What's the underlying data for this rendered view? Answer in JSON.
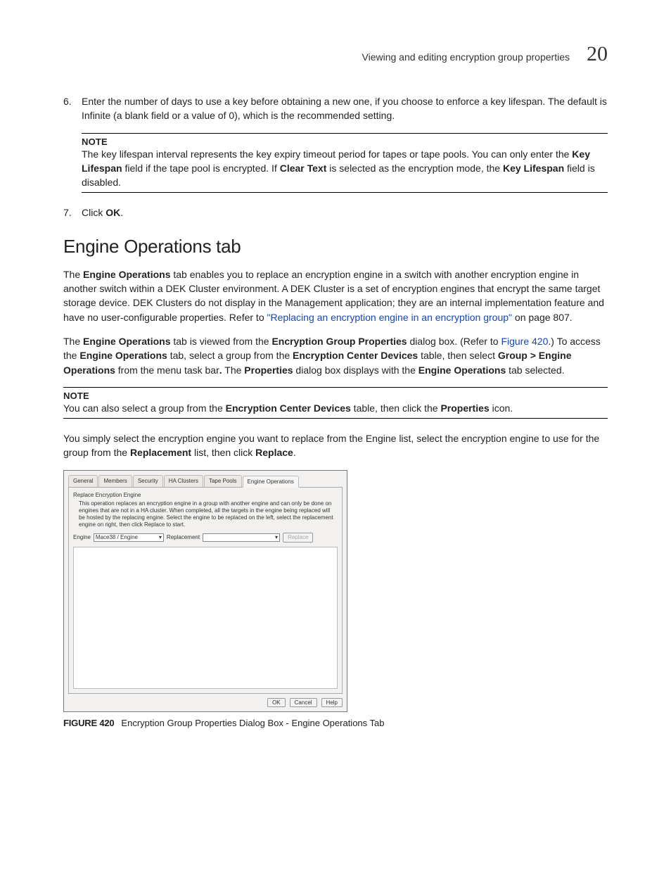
{
  "header": {
    "title": "Viewing and editing encryption group properties",
    "chapter": "20"
  },
  "step6_num": "6.",
  "step6_text": "Enter the number of days to use a key before obtaining a new one, if you choose to enforce a key lifespan. The default is Infinite (a blank field or a value of 0), which is the recommended setting.",
  "note1_head": "NOTE",
  "note1_a": "The key lifespan interval represents the key expiry timeout period for tapes or tape pools. You can only enter the ",
  "note1_b": "Key Lifespan",
  "note1_c": " field if the tape pool is encrypted. If ",
  "note1_d": "Clear Text",
  "note1_e": " is selected as the encryption mode, the ",
  "note1_f": "Key Lifespan",
  "note1_g": " field is disabled.",
  "step7_num": "7.",
  "step7_a": "Click ",
  "step7_b": "OK",
  "step7_c": ".",
  "h2": "Engine Operations tab",
  "p1_a": "The ",
  "p1_b": "Engine Operations",
  "p1_c": " tab enables you to replace an encryption engine in a switch with another encryption engine in another switch within a DEK Cluster environment. A DEK Cluster is a set of encryption engines that encrypt the same target storage device. DEK Clusters do not display in the Management application; they are an internal implementation feature and have no user-configurable properties. Refer to ",
  "p1_link": "\"Replacing an encryption engine in an encryption group\"",
  "p1_d": " on page 807.",
  "p2_a": "The ",
  "p2_b": "Engine Operations",
  "p2_c": " tab is viewed from the ",
  "p2_d": "Encryption Group Properties",
  "p2_e": " dialog box. (Refer to ",
  "p2_link": "Figure 420",
  "p2_f": ".) To access the ",
  "p2_g": "Engine Operations",
  "p2_h": " tab, select a group from the ",
  "p2_i": "Encryption Center Devices",
  "p2_j": " table, then select ",
  "p2_k": "Group > Engine Operations",
  "p2_l": " from the menu task bar",
  "p2_m": ".",
  "p2_n": " The ",
  "p2_o": "Properties",
  "p2_p": " dialog box displays with the ",
  "p2_q": "Engine Operations",
  "p2_r": " tab selected.",
  "note2_head": "NOTE",
  "note2_a": "You can also select a group from the ",
  "note2_b": "Encryption Center Devices",
  "note2_c": " table, then click the ",
  "note2_d": "Properties",
  "note2_e": " icon.",
  "p3_a": "You simply select the encryption engine you want to replace from the Engine list, select the encryption engine to use for the group from the ",
  "p3_b": "Replacement",
  "p3_c": " list, then click ",
  "p3_d": "Replace",
  "p3_e": ".",
  "dialog": {
    "tabs": [
      "General",
      "Members",
      "Security",
      "HA Clusters",
      "Tape Pools",
      "Engine Operations"
    ],
    "section_title": "Replace Encryption Engine",
    "section_desc": "This operation replaces an encryption engine in a group with another engine and can only be done on engines that are not in a HA cluster. When completed, all the targets in the engine being replaced will be hosted by the replacing engine. Select the engine to be replaced on the left, select the replacement engine on right, then click Replace to start.",
    "engine_label": "Engine",
    "engine_value": "Mace38 / Engine",
    "repl_label": "Replacement",
    "replace_btn": "Replace",
    "ok": "OK",
    "cancel": "Cancel",
    "help": "Help"
  },
  "fig_label": "FIGURE 420",
  "fig_caption": "Encryption Group Properties Dialog Box - Engine Operations Tab"
}
